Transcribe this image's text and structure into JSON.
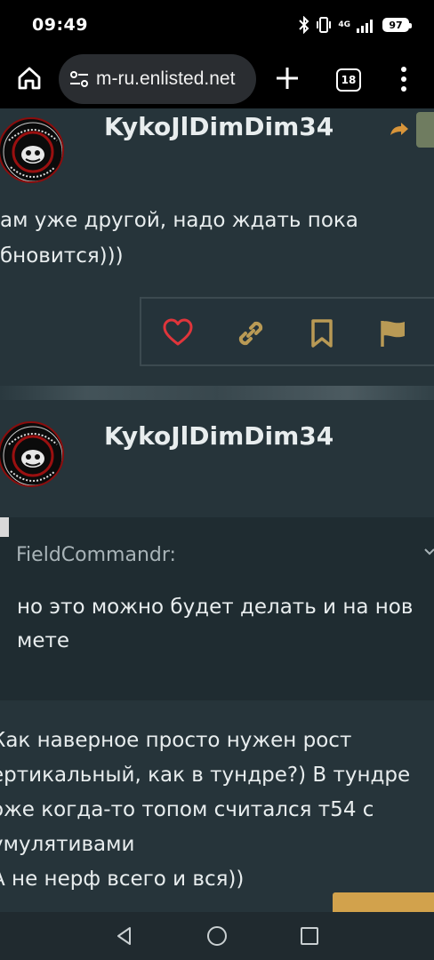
{
  "status": {
    "time": "09:49",
    "network": "4G",
    "battery": "97"
  },
  "browser": {
    "url": "m-ru.enlisted.net",
    "tab_count": "18"
  },
  "posts": [
    {
      "username": "KykoJlDimDim34",
      "avatar": {
        "ring_text_top": "Jabner Group",
        "ring_text_bottom": "Группа Жабнера"
      },
      "lines": [
        "ам уже другой, надо ждать пока",
        "бновится)))"
      ]
    },
    {
      "username": "KykoJlDimDim34",
      "avatar": {
        "ring_text_top": "Jabner Group",
        "ring_text_bottom": "Группа Жабнера"
      },
      "quote": {
        "author": "FieldCommandr:",
        "lines": [
          "но это можно будет делать и на нов",
          "мете"
        ]
      },
      "lines": [
        "Как наверное просто нужен рост",
        "ертикальный, как в тундре?) В тундре",
        "оже когда-то топом считался т54 с",
        "умулятивами",
        "А не нерф всего и вся))"
      ]
    }
  ],
  "colors": {
    "background": "#26343a",
    "heart": "#e0353b",
    "accent": "#b99a55"
  }
}
